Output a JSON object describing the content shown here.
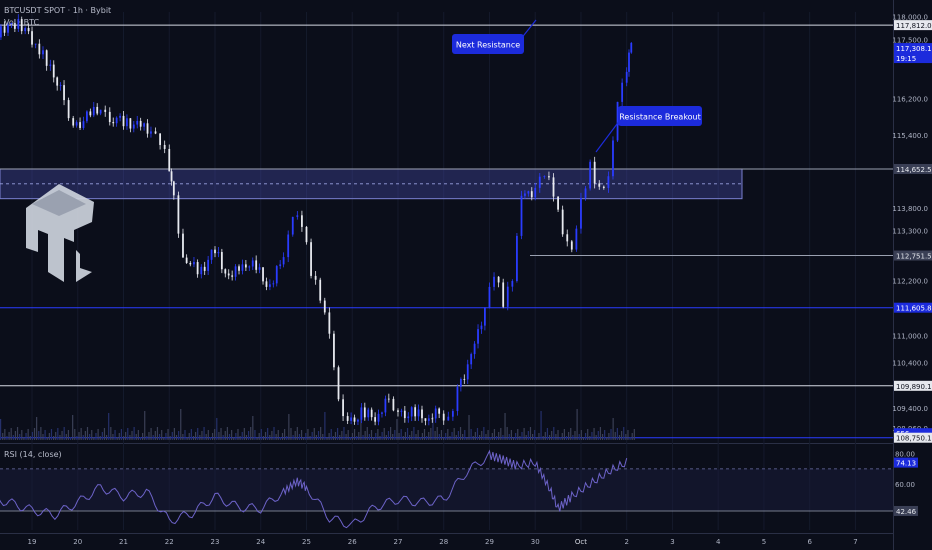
{
  "header": {
    "symbol_line": "BTCUSDT SPOT · 1h · Bybit",
    "volume_label": "Vol · BTC",
    "rsi_label": "RSI (14, close)"
  },
  "price_axis": {
    "ticks": [
      {
        "label": "118,000.0",
        "value": 118000
      },
      {
        "label": "117,500.0",
        "value": 117500
      },
      {
        "label": "116,200.0",
        "value": 116200
      },
      {
        "label": "115,400.0",
        "value": 115400
      },
      {
        "label": "113,800.0",
        "value": 113800
      },
      {
        "label": "113,300.0",
        "value": 113300
      },
      {
        "label": "112,200.0",
        "value": 112200
      },
      {
        "label": "111,000.0",
        "value": 111000
      },
      {
        "label": "110,400.0",
        "value": 110400
      },
      {
        "label": "109,400.0",
        "value": 109400
      },
      {
        "label": "108,960.0",
        "value": 108960
      }
    ],
    "badges": [
      {
        "label": "117,812.0",
        "value": 117812,
        "style": "white"
      },
      {
        "label": "117,308.1",
        "value": 117308.1,
        "style": "blue",
        "sub": "19:15"
      },
      {
        "label": "114,652.5",
        "value": 114652.5,
        "style": "grey"
      },
      {
        "label": "112,751.5",
        "value": 112751.5,
        "style": "grey"
      },
      {
        "label": "111,605.8",
        "value": 111605.8,
        "style": "blue"
      },
      {
        "label": "109,890.1",
        "value": 109890.1,
        "style": "white"
      },
      {
        "label": "656",
        "value": 108850,
        "style": "blue"
      },
      {
        "label": "108,750.1",
        "value": 108750.1,
        "style": "white"
      }
    ]
  },
  "rsi_axis": {
    "ticks": [
      {
        "label": "80.00",
        "value": 80
      },
      {
        "label": "60.00",
        "value": 60
      }
    ],
    "badges": [
      {
        "label": "74.13",
        "value": 74.13,
        "style": "blue"
      },
      {
        "label": "42.46",
        "value": 42.46,
        "style": "grey"
      }
    ]
  },
  "time_axis": {
    "labels": [
      "19",
      "20",
      "21",
      "22",
      "23",
      "24",
      "25",
      "26",
      "27",
      "28",
      "29",
      "30",
      "Oct",
      "2",
      "3",
      "4",
      "5",
      "6",
      "7"
    ]
  },
  "annotations": {
    "next_resistance": "Next Resistance",
    "resistance_breakout": "Resistance Breakout"
  },
  "colors": {
    "background": "#0b0e1a",
    "accent": "#1c2bdc",
    "zone": "#4a50b8",
    "candle_up": "#2a3cff",
    "candle_down": "#e8eaf0",
    "rsi_line": "#6d63c9"
  },
  "chart_data": {
    "type": "candlestick",
    "symbol": "BTCUSDT",
    "timeframe": "1h",
    "x_dates": [
      "19",
      "20",
      "21",
      "22",
      "23",
      "24",
      "25",
      "26",
      "27",
      "28",
      "29",
      "30",
      "Oct",
      "2",
      "3",
      "4",
      "5",
      "6",
      "7"
    ],
    "ylim": [
      108700,
      118100
    ],
    "last_price": 117308.1,
    "close_path": [
      {
        "day": 18.0,
        "price": 117600
      },
      {
        "day": 18.4,
        "price": 117700
      },
      {
        "day": 18.7,
        "price": 117900
      },
      {
        "day": 19.0,
        "price": 117500
      },
      {
        "day": 19.4,
        "price": 116900
      },
      {
        "day": 19.7,
        "price": 116200
      },
      {
        "day": 19.9,
        "price": 115500
      },
      {
        "day": 20.2,
        "price": 115800
      },
      {
        "day": 20.5,
        "price": 116000
      },
      {
        "day": 20.7,
        "price": 115800
      },
      {
        "day": 21.0,
        "price": 115700
      },
      {
        "day": 21.3,
        "price": 115600
      },
      {
        "day": 21.6,
        "price": 115500
      },
      {
        "day": 21.8,
        "price": 115300
      },
      {
        "day": 22.0,
        "price": 114700
      },
      {
        "day": 22.1,
        "price": 114000
      },
      {
        "day": 22.3,
        "price": 112700
      },
      {
        "day": 22.7,
        "price": 112400
      },
      {
        "day": 23.0,
        "price": 112900
      },
      {
        "day": 23.3,
        "price": 112200
      },
      {
        "day": 23.6,
        "price": 112600
      },
      {
        "day": 23.9,
        "price": 112500
      },
      {
        "day": 24.2,
        "price": 112000
      },
      {
        "day": 24.5,
        "price": 112800
      },
      {
        "day": 24.7,
        "price": 113700
      },
      {
        "day": 24.9,
        "price": 113500
      },
      {
        "day": 25.1,
        "price": 112400
      },
      {
        "day": 25.3,
        "price": 111800
      },
      {
        "day": 25.5,
        "price": 111000
      },
      {
        "day": 25.7,
        "price": 109500
      },
      {
        "day": 25.9,
        "price": 109000
      },
      {
        "day": 26.2,
        "price": 109300
      },
      {
        "day": 26.5,
        "price": 109200
      },
      {
        "day": 26.8,
        "price": 109600
      },
      {
        "day": 27.0,
        "price": 109200
      },
      {
        "day": 27.3,
        "price": 109300
      },
      {
        "day": 27.6,
        "price": 109200
      },
      {
        "day": 27.9,
        "price": 109300
      },
      {
        "day": 28.1,
        "price": 109100
      },
      {
        "day": 28.3,
        "price": 109800
      },
      {
        "day": 28.6,
        "price": 110500
      },
      {
        "day": 28.9,
        "price": 111600
      },
      {
        "day": 29.1,
        "price": 112400
      },
      {
        "day": 29.3,
        "price": 111700
      },
      {
        "day": 29.5,
        "price": 112200
      },
      {
        "day": 29.7,
        "price": 114000
      },
      {
        "day": 30.0,
        "price": 114200
      },
      {
        "day": 30.2,
        "price": 114600
      },
      {
        "day": 30.4,
        "price": 114100
      },
      {
        "day": 30.6,
        "price": 113200
      },
      {
        "day": 30.8,
        "price": 112800
      },
      {
        "day": 31.0,
        "price": 113900
      },
      {
        "day": 31.2,
        "price": 114700
      },
      {
        "day": 31.4,
        "price": 114200
      },
      {
        "day": 31.6,
        "price": 114500
      },
      {
        "day": 31.8,
        "price": 116200
      },
      {
        "day": 32.0,
        "price": 116900
      },
      {
        "day": 32.1,
        "price": 117300
      }
    ],
    "horizontal_levels": [
      {
        "price": 117812.0,
        "style": "white"
      },
      {
        "price": 114652.5,
        "style": "grey"
      },
      {
        "price": 112751.5,
        "style": "grey"
      },
      {
        "price": 111605.8,
        "style": "blue"
      },
      {
        "price": 109890.1,
        "style": "white"
      },
      {
        "price": 108750.1,
        "style": "blue"
      }
    ],
    "zone": {
      "price_low": 114000,
      "price_high": 114652.5
    },
    "rsi": {
      "ylim": [
        30,
        85
      ],
      "levels": [
        70,
        42.46
      ],
      "last": 74.13,
      "points": [
        {
          "day": 18.0,
          "value": 52
        },
        {
          "day": 18.5,
          "value": 48
        },
        {
          "day": 19.0,
          "value": 43
        },
        {
          "day": 19.5,
          "value": 40
        },
        {
          "day": 20.0,
          "value": 48
        },
        {
          "day": 20.5,
          "value": 58
        },
        {
          "day": 21.0,
          "value": 52
        },
        {
          "day": 21.5,
          "value": 55
        },
        {
          "day": 22.0,
          "value": 36
        },
        {
          "day": 22.5,
          "value": 41
        },
        {
          "day": 23.0,
          "value": 52
        },
        {
          "day": 23.5,
          "value": 45
        },
        {
          "day": 24.0,
          "value": 44
        },
        {
          "day": 24.5,
          "value": 55
        },
        {
          "day": 24.8,
          "value": 62
        },
        {
          "day": 25.0,
          "value": 58
        },
        {
          "day": 25.5,
          "value": 38
        },
        {
          "day": 26.0,
          "value": 33
        },
        {
          "day": 26.5,
          "value": 45
        },
        {
          "day": 27.0,
          "value": 50
        },
        {
          "day": 27.5,
          "value": 48
        },
        {
          "day": 28.0,
          "value": 50
        },
        {
          "day": 28.5,
          "value": 68
        },
        {
          "day": 29.0,
          "value": 79
        },
        {
          "day": 29.3,
          "value": 76
        },
        {
          "day": 29.6,
          "value": 72
        },
        {
          "day": 30.0,
          "value": 74
        },
        {
          "day": 30.3,
          "value": 58
        },
        {
          "day": 30.5,
          "value": 44
        },
        {
          "day": 30.8,
          "value": 52
        },
        {
          "day": 31.2,
          "value": 60
        },
        {
          "day": 31.6,
          "value": 68
        },
        {
          "day": 32.0,
          "value": 74.13
        }
      ]
    }
  }
}
